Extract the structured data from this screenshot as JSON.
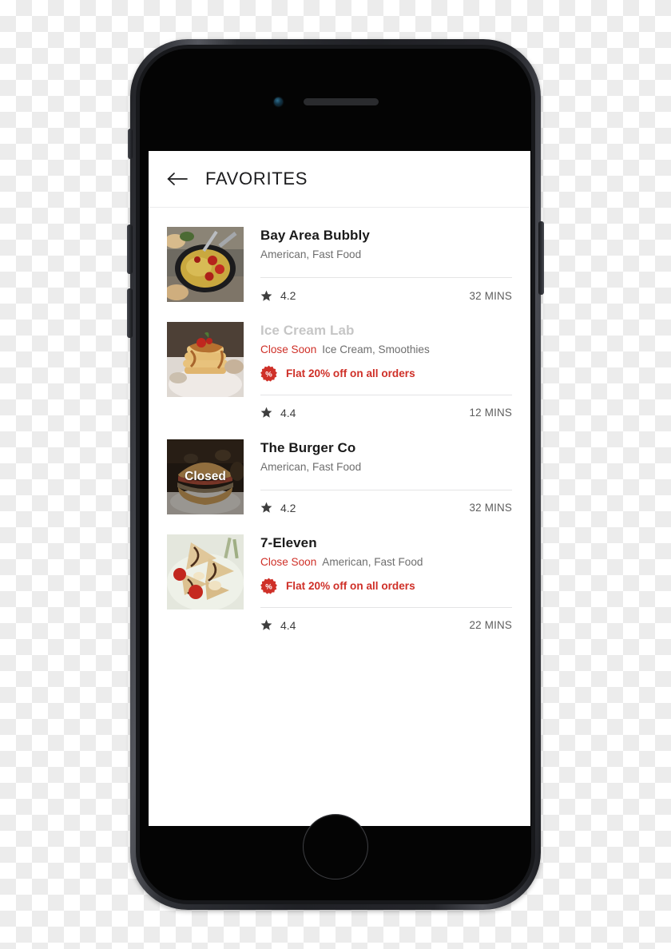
{
  "app": {
    "header": {
      "back_icon": "arrow-left-icon",
      "title": "FAVORITES"
    }
  },
  "restaurants": [
    {
      "name": "Bay Area Bubbly",
      "dimmed": false,
      "close_soon": "",
      "cuisine": "American, Fast Food",
      "offer": "",
      "offer_icon": "discount-percent-badge-icon",
      "rating": "4.2",
      "eta": "32 MINS",
      "closed_label": "",
      "thumb": "skillet-vegetables-tomatoes-photo"
    },
    {
      "name": "Ice Cream Lab",
      "dimmed": true,
      "close_soon": "Close Soon",
      "cuisine": "Ice Cream, Smoothies",
      "offer": "Flat 20% off on all orders",
      "offer_icon": "discount-percent-badge-icon",
      "rating": "4.4",
      "eta": "12 MINS",
      "closed_label": "",
      "thumb": "pancake-stack-strawberry-photo"
    },
    {
      "name": "The Burger Co",
      "dimmed": false,
      "close_soon": "",
      "cuisine": "American, Fast Food",
      "offer": "",
      "offer_icon": "discount-percent-badge-icon",
      "rating": "4.2",
      "eta": "32 MINS",
      "closed_label": "Closed",
      "thumb": "burger-sandwich-photo"
    },
    {
      "name": "7-Eleven",
      "dimmed": false,
      "close_soon": "Close Soon",
      "cuisine": "American, Fast Food",
      "offer": "Flat 20% off on all orders",
      "offer_icon": "discount-percent-badge-icon",
      "rating": "4.4",
      "eta": "22 MINS",
      "closed_label": "",
      "thumb": "crepes-berries-chocolate-photo"
    }
  ],
  "colors": {
    "accent_red": "#cf3028",
    "title_dark": "#1a1a1a",
    "muted_gray": "#6e6e6e",
    "dim_gray": "#c6c6c6",
    "divider": "#e4e4e5"
  }
}
